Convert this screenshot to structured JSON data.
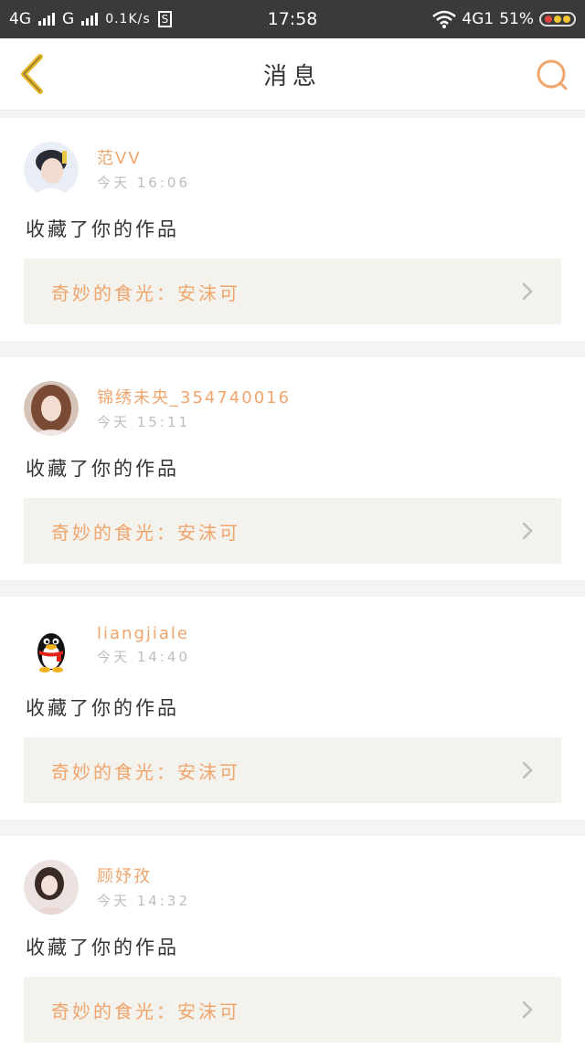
{
  "status_bar": {
    "network1": "4G",
    "network2": "G",
    "speed": "0.1K/s",
    "s_badge": "S",
    "time": "17:58",
    "network3": "4G1",
    "battery_percent": "51%"
  },
  "header": {
    "title": "消息"
  },
  "messages": [
    {
      "user": "范VV",
      "time": "今天 16:06",
      "action": "收藏了你的作品",
      "work_title": "奇妙的食光：安沫可"
    },
    {
      "user": "锦绣未央_354740016",
      "time": "今天 15:11",
      "action": "收藏了你的作品",
      "work_title": "奇妙的食光：安沫可"
    },
    {
      "user": "liangjiale",
      "time": "今天 14:40",
      "action": "收藏了你的作品",
      "work_title": "奇妙的食光：安沫可"
    },
    {
      "user": "顾妤孜",
      "time": "今天 14:32",
      "action": "收藏了你的作品",
      "work_title": "奇妙的食光：安沫可"
    }
  ],
  "colors": {
    "accent": "#f0a56c",
    "back_icon": "#e6b82a",
    "statusbar_bg": "#3a3a3a",
    "card_inner_bg": "#f3f2ed"
  }
}
